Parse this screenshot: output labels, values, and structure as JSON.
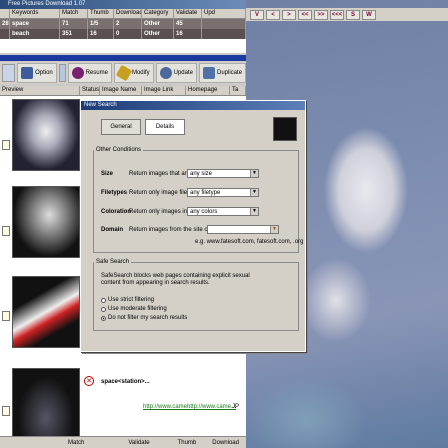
{
  "window": {
    "title": "Free Pictures Download 1.07"
  },
  "keywords_grid": {
    "columns": [
      "Keywords",
      "Match",
      "Thumb",
      "Download",
      "Category",
      "Validate",
      "Upd"
    ],
    "rows": [
      {
        "marker": "28",
        "keyword": "space",
        "match": "71",
        "thumb": "1/5",
        "download": "2",
        "category": "Other",
        "validate": "45"
      },
      {
        "marker": "",
        "keyword": "beach",
        "match": "351",
        "thumb": "16",
        "download": "0",
        "category": "Other",
        "validate": "16"
      }
    ]
  },
  "toolbar": {
    "buttons": [
      {
        "label": "Option",
        "icon": "option-icon"
      },
      {
        "label": "Resume",
        "icon": "resume-icon"
      },
      {
        "label": "Modify",
        "icon": "pencil-icon"
      },
      {
        "label": "Update",
        "icon": "magnifier-icon"
      },
      {
        "label": "Duplicate",
        "icon": "duplicate-icon"
      }
    ]
  },
  "photo_toolbar": {
    "buttons": [
      "V",
      "<",
      ">",
      "<<",
      ">>",
      "<<<",
      "S",
      "W"
    ]
  },
  "results_grid": {
    "columns": [
      "Preview",
      "Status",
      "Image Name",
      "Image Link",
      "Homepage",
      "Ta"
    ],
    "last_row": {
      "name": "space<station>...",
      "link": "http://www.came...",
      "homepage": "http://www.came...",
      "type": "JP"
    }
  },
  "status_bar": {
    "items": [
      "Match",
      "Validate",
      "Thumb",
      "Download"
    ]
  },
  "dialog": {
    "title": "New Search",
    "tabs": [
      "General",
      "Details"
    ],
    "active_tab": "Details",
    "other_conditions": {
      "legend": "Other Conditions",
      "rows": [
        {
          "label": "Size",
          "desc": "Return images that are",
          "value": "any size"
        },
        {
          "label": "Filetypes",
          "desc": "Return only image files for",
          "value": "any filetype"
        },
        {
          "label": "Coloration",
          "desc": "Return only images in",
          "value": "any colors"
        },
        {
          "label": "Domain",
          "desc": "Return images from the site or domain",
          "value": ""
        }
      ],
      "domain_hint": "e.g. www.fatesoft.com, fatesoft.com, .org"
    },
    "safe_search": {
      "legend": "Safe Search",
      "description": "SafeSearch blocks web pages containing explicit sexual content from appearing in search results.",
      "options": [
        "Use strict filtering",
        "Use moderate filtering",
        "Do not filter my search results"
      ],
      "selected": 2
    }
  },
  "colors": {
    "title_bar": "#2a4a7a",
    "accent_blue": "#1a3aa0",
    "row_highlight": "#7a7070"
  }
}
